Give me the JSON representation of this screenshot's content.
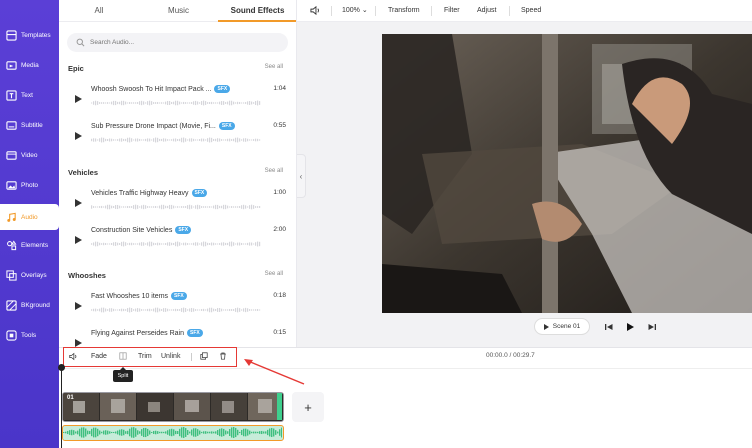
{
  "sidebar": {
    "items": [
      {
        "label": "Templates",
        "icon": "templates-icon"
      },
      {
        "label": "Media",
        "icon": "media-icon"
      },
      {
        "label": "Text",
        "icon": "text-icon"
      },
      {
        "label": "Subtitle",
        "icon": "subtitle-icon"
      },
      {
        "label": "Video",
        "icon": "video-icon"
      },
      {
        "label": "Photo",
        "icon": "photo-icon"
      },
      {
        "label": "Audio",
        "icon": "audio-icon"
      },
      {
        "label": "Elements",
        "icon": "elements-icon"
      },
      {
        "label": "Overlays",
        "icon": "overlays-icon"
      },
      {
        "label": "BKground",
        "icon": "background-icon"
      },
      {
        "label": "Tools",
        "icon": "tools-icon"
      }
    ],
    "active": "Audio"
  },
  "library": {
    "tabs": [
      "All",
      "Music",
      "Sound Effects"
    ],
    "active_tab": "Sound Effects",
    "search_placeholder": "Search Audio...",
    "sections": [
      {
        "title": "Epic",
        "see_all": "See all",
        "tracks": [
          {
            "name": "Whoosh Swoosh To Hit Impact Pack ...",
            "badge": "SFX",
            "duration": "1:04"
          },
          {
            "name": "Sub Pressure Drone Impact (Movie, Fi...",
            "badge": "SFX",
            "duration": "0:55"
          }
        ]
      },
      {
        "title": "Vehicles",
        "see_all": "See all",
        "tracks": [
          {
            "name": "Vehicles Traffic Highway Heavy",
            "badge": "SFX",
            "duration": "1:00"
          },
          {
            "name": "Construction Site Vehicles",
            "badge": "SFX",
            "duration": "2:00"
          }
        ]
      },
      {
        "title": "Whooshes",
        "see_all": "See all",
        "tracks": [
          {
            "name": "Fast Whooshes 10 items",
            "badge": "SFX",
            "duration": "0:18"
          },
          {
            "name": "Flying Against Perseides Rain",
            "badge": "SFX",
            "duration": "0:15"
          }
        ]
      }
    ]
  },
  "toolbar": {
    "zoom": "100%",
    "transform": "Transform",
    "filter": "Filter",
    "adjust": "Adjust",
    "speed": "Speed"
  },
  "player": {
    "scene_label": "Scene 01"
  },
  "timeline": {
    "fade": "Fade",
    "trim": "Trim",
    "unlink": "Unlink",
    "tooltip": "Split",
    "time": "00:00.0 / 00:29.7",
    "clip_label": "01",
    "add": "+"
  },
  "colors": {
    "sidebar": "#5b3fd6",
    "accent": "#f29a29",
    "sfx_badge": "#4aa8e8",
    "highlight": "#e53935",
    "audio_track": "#c7ecd9"
  }
}
